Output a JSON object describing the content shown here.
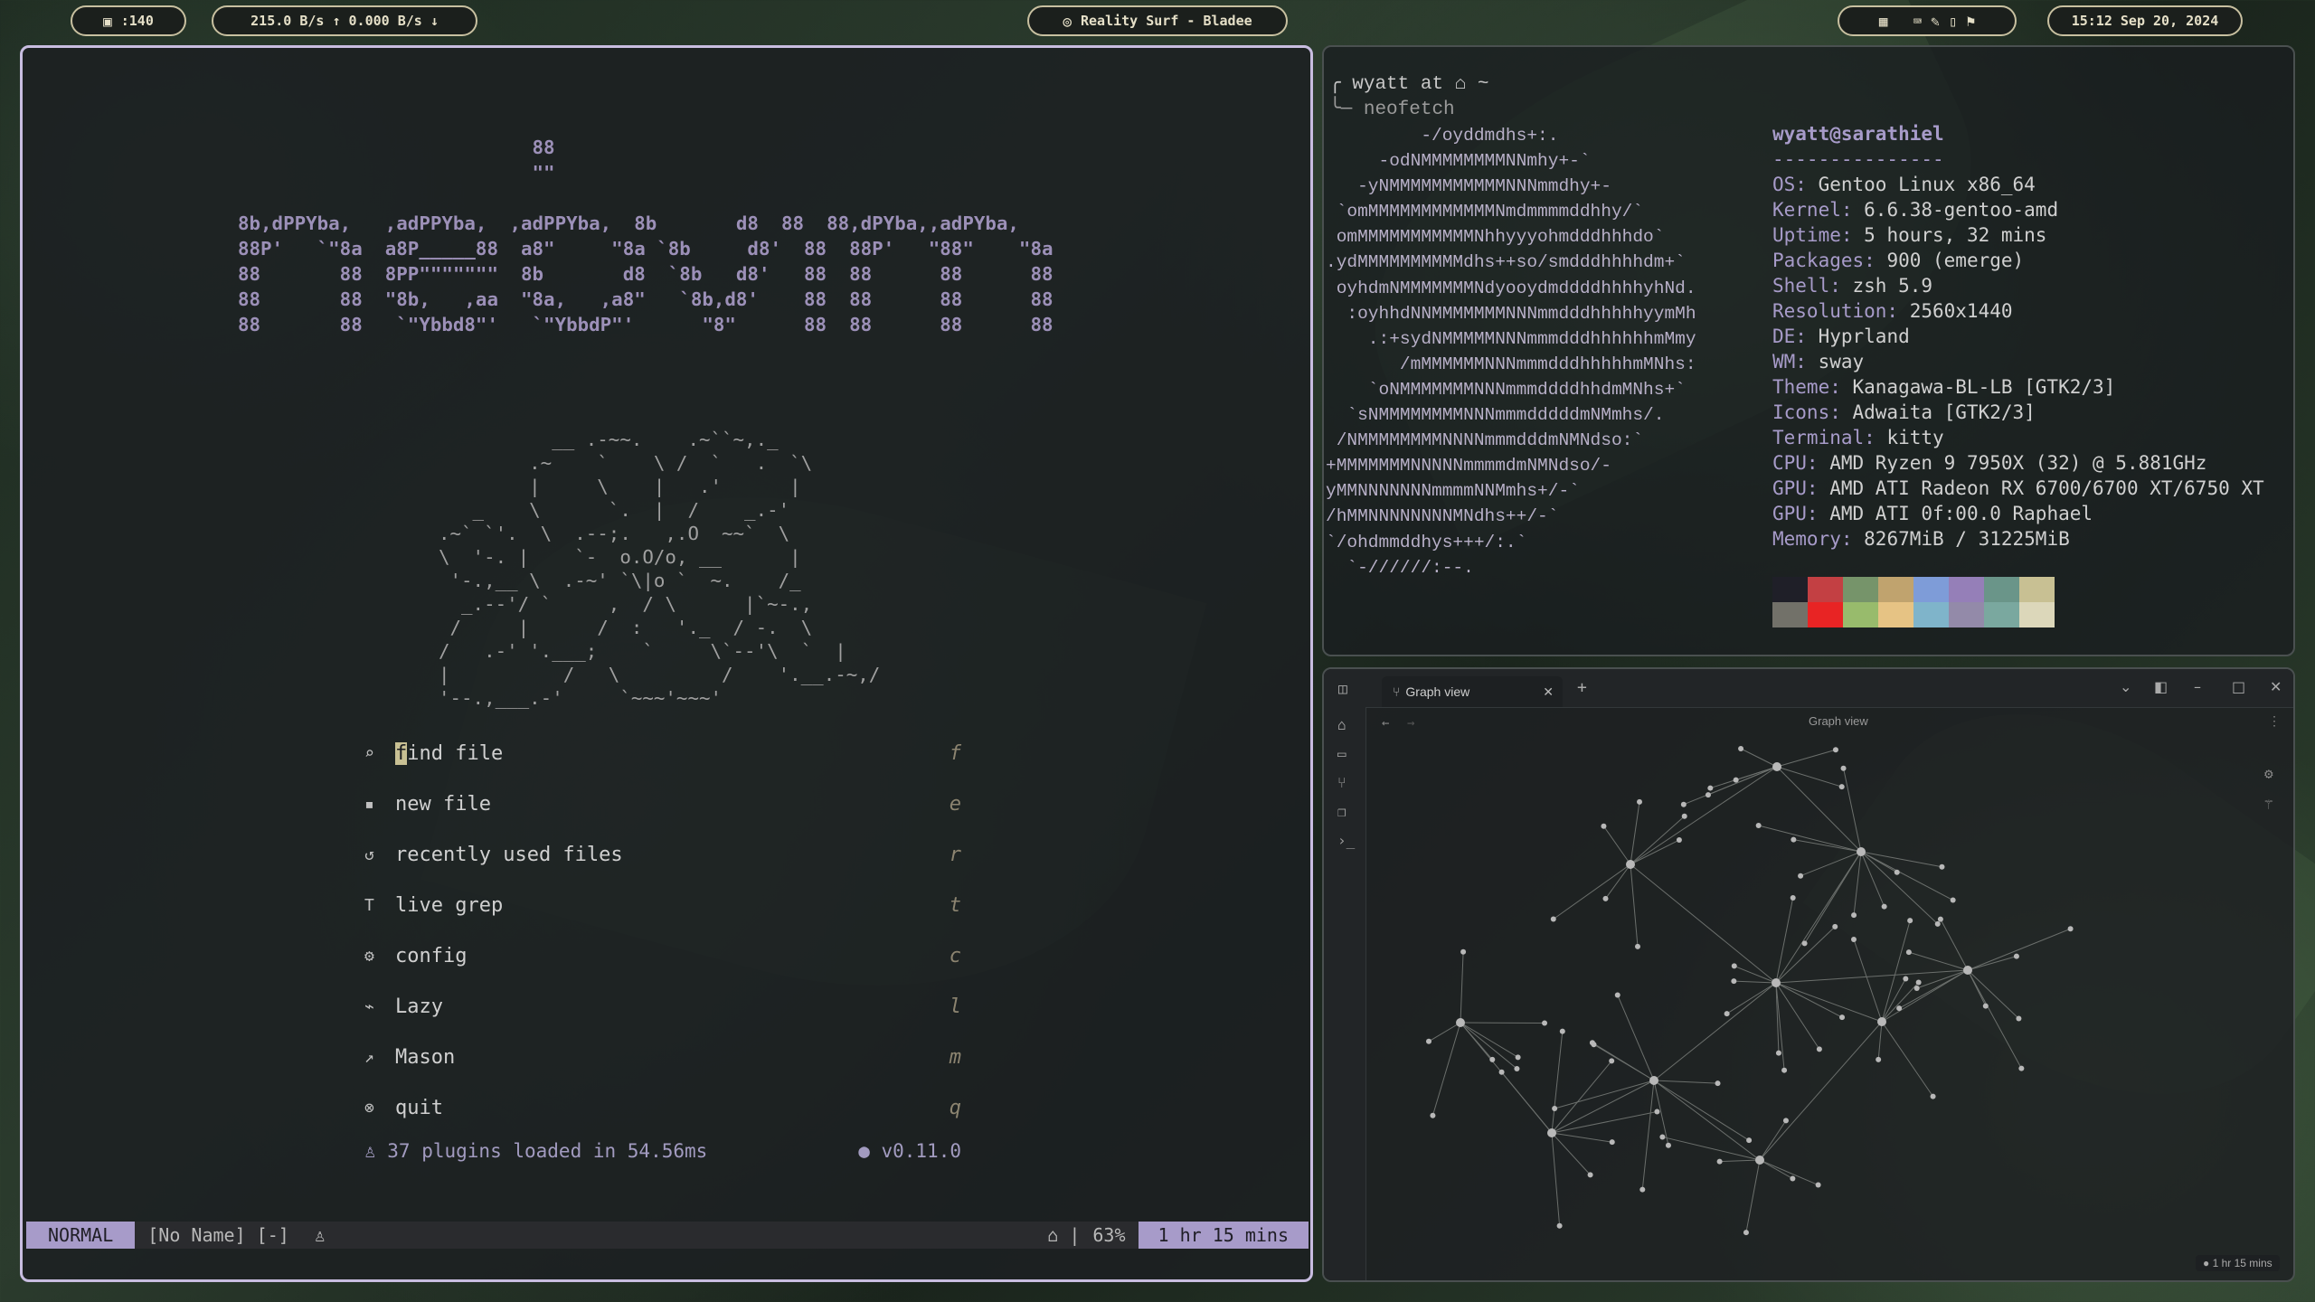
{
  "topbar": {
    "workspace": ":140",
    "network": "215.0  B/s ↑ 0.000  B/s ↓",
    "media": "Reality Surf - Bladee",
    "clock": "15:12 Sep 20, 2024"
  },
  "nvim": {
    "header_art": "                          88\n                          \"\"\n\n8b,dPPYba,   ,adPPYba,  ,adPPYba,  8b       d8  88  88,dPYba,,adPYba,\n88P'   `\"8a  a8P_____88  a8\"     \"8a `8b     d8'  88  88P'   \"88\"    \"8a\n88       88  8PP\"\"\"\"\"\"\"  8b       d8  `8b   d8'   88  88      88      88\n88       88  \"8b,   ,aa  \"8a,   ,a8\"   `8b,d8'    88  88      88      88\n88       88   `\"Ybbd8\"'   `\"YbbdP\"'      \"8\"      88  88      88      88",
    "butterfly_art": "          __ .-~~.    .~``~,._\n        .~    `    \\ /  `   .  `\\\n        |     \\    |   .'      |\n   _    \\      `.  |  /    _.-'\n.~` `'.  \\  .--;.   ,.O  ~~`  \\\n\\  '-. |    `-  o.O/o, __      |\n '-.,__ \\  .-~' `\\|o `  ~.    /_\n  _.--'/ `     ,  / \\      |`~-.,\n /     |      /  :   '._  / -.  \\\n/   .-' '.___;    `     \\`--'\\  `  |\n|          /   \\         /    '.__.-~,/\n'--.,___.-'     `~~~'~~~'",
    "menu": [
      {
        "icon": "⌕",
        "label": "find file",
        "key": "f"
      },
      {
        "icon": "▪",
        "label": "new file",
        "key": "e"
      },
      {
        "icon": "↺",
        "label": "recently used files",
        "key": "r"
      },
      {
        "icon": "T",
        "label": "live grep",
        "key": "t"
      },
      {
        "icon": "⚙",
        "label": "config",
        "key": "c"
      },
      {
        "icon": "⌁",
        "label": "Lazy",
        "key": "l"
      },
      {
        "icon": "↗",
        "label": "Mason",
        "key": "m"
      },
      {
        "icon": "⊗",
        "label": "quit",
        "key": "q"
      }
    ],
    "plugins_text": "♙ 37 plugins loaded in 54.56ms",
    "version": "● v0.11.0",
    "status": {
      "mode": "NORMAL",
      "buffer": "[No Name] [-]",
      "percent": "63%",
      "time": "1 hr 15 mins"
    }
  },
  "terminal": {
    "prompt_line1": "╭ wyatt at ⌂ ~",
    "prompt_line2": "╰─ neofetch",
    "logo": "         -/oyddmdhs+:.\n     -odNMMMMMMMMNNmhy+-`\n   -yNMMMMMMMMMMMNNNmmdhy+-\n `omMMMMMMMMMMMMNmdmmmmddhhy/`\n omMMMMMMMMMMMNhhyyyohmdddhhhdo`\n.ydMMMMMMMMMMdhs++so/smdddhhhhdm+`\n oyhdmNMMMMMMMNdyooydmddddhhhhyhNd.\n  :oyhhdNNMMMMMMMNNNmmdddhhhhhyymMh\n    .:+sydNMMMMMNNNmmmdddhhhhhhmMmy\n       /mMMMMMMNNNmmmdddhhhhhmMNhs:\n    `oNMMMMMMMNNNmmmddddhhdmMNhs+`\n  `sNMMMMMMMMNNNmmmdddddmNMmhs/.\n /NMMMMMMMMNNNNmmmdddmNMNdso:`\n+MMMMMMMNNNNNmmmmdmNMNdso/-\nyMMNNNNNNNmmmmNNMmhs+/-`\n/hMMNNNNNNNNMNdhs++/-`\n`/ohdmmddhys+++/:.`\n  `-//////:--.",
    "user_host": "wyatt@sarathiel",
    "separator": "---------------",
    "info": [
      {
        "key": "OS",
        "value": " Gentoo Linux x86_64"
      },
      {
        "key": "Kernel",
        "value": " 6.6.38-gentoo-amd"
      },
      {
        "key": "Uptime",
        "value": " 5 hours, 32 mins"
      },
      {
        "key": "Packages",
        "value": " 900 (emerge)"
      },
      {
        "key": "Shell",
        "value": " zsh 5.9"
      },
      {
        "key": "Resolution",
        "value": " 2560x1440"
      },
      {
        "key": "DE",
        "value": " Hyprland"
      },
      {
        "key": "WM",
        "value": " sway"
      },
      {
        "key": "Theme",
        "value": " Kanagawa-BL-LB [GTK2/3]"
      },
      {
        "key": "Icons",
        "value": " Adwaita [GTK2/3]"
      },
      {
        "key": "Terminal",
        "value": " kitty"
      },
      {
        "key": "CPU",
        "value": " AMD Ryzen 9 7950X (32) @ 5.881GHz"
      },
      {
        "key": "GPU",
        "value": " AMD ATI Radeon RX 6700/6700 XT/6750 XT"
      },
      {
        "key": "GPU",
        "value": " AMD ATI 0f:00.0 Raphael"
      },
      {
        "key": "Memory",
        "value": " 8267MiB / 31225MiB"
      }
    ],
    "palette_top": [
      "#1f1f28",
      "#c34043",
      "#76946a",
      "#c0a36e",
      "#7e9cd8",
      "#957fb8",
      "#6a9589",
      "#c8c093"
    ],
    "palette_bottom": [
      "#727169",
      "#e82424",
      "#98bb6c",
      "#e6c384",
      "#7fb4ca",
      "#938aa9",
      "#7aa89f",
      "#dcd7ba"
    ]
  },
  "obsidian": {
    "tab_label": "Graph view",
    "graph_title": "Graph view",
    "status_time": "1 hr 15 mins"
  }
}
